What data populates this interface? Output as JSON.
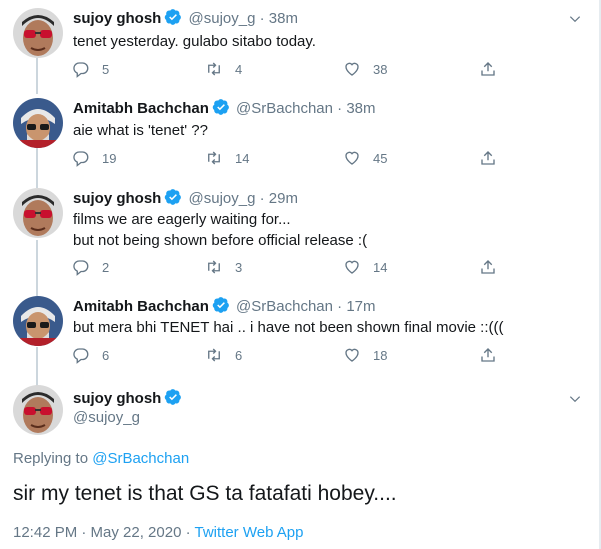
{
  "tweets": [
    {
      "name": "sujoy ghosh",
      "handle": "@sujoy_g",
      "sep": "·",
      "time": "38m",
      "text": [
        "tenet yesterday. gulabo sitabo today."
      ],
      "replies": "5",
      "retweets": "4",
      "likes": "38"
    },
    {
      "name": "Amitabh Bachchan",
      "handle": "@SrBachchan",
      "sep": "·",
      "time": "38m",
      "text": [
        "aie what is 'tenet' ??"
      ],
      "replies": "19",
      "retweets": "14",
      "likes": "45"
    },
    {
      "name": "sujoy ghosh",
      "handle": "@sujoy_g",
      "sep": "·",
      "time": "29m",
      "text": [
        "films we are eagerly waiting for...",
        "but not being shown before official release :("
      ],
      "replies": "2",
      "retweets": "3",
      "likes": "14"
    },
    {
      "name": "Amitabh Bachchan",
      "handle": "@SrBachchan",
      "sep": "·",
      "time": "17m",
      "text": [
        "but mera bhi TENET hai .. i have not been shown final movie ::((("
      ],
      "replies": "6",
      "retweets": "6",
      "likes": "18"
    }
  ],
  "focus": {
    "name": "sujoy ghosh",
    "handle": "@sujoy_g",
    "replying_prefix": "Replying to",
    "replying_to": "@SrBachchan",
    "text": "sir my tenet is that GS ta fatafati hobey....",
    "timestamp": "12:42 PM · May 22, 2020 · ",
    "source": "Twitter Web App"
  },
  "colors": {
    "verified": "#1da1f2",
    "muted": "#657786",
    "link": "#1da1f2",
    "thread_line": "#ccd6dd"
  }
}
